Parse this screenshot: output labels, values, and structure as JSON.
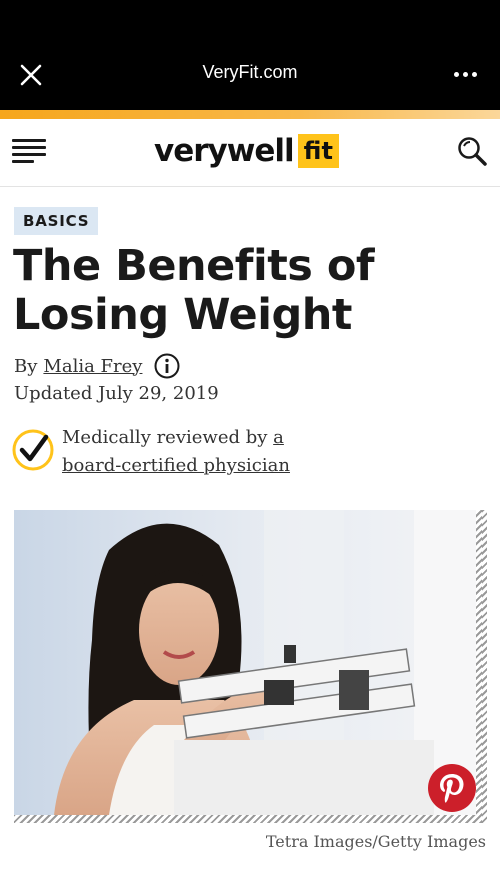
{
  "browser": {
    "title": "VeryFit.com",
    "close_icon": "close-icon",
    "more_icon": "more-options-icon"
  },
  "site": {
    "logo_text": "verywell",
    "logo_badge": "fit",
    "menu_icon": "hamburger-menu-icon",
    "search_icon": "search-icon",
    "accent_color": "#ffc31a"
  },
  "article": {
    "category": "BASICS",
    "title": "The Benefits of Losing Weight",
    "byline_prefix": "By",
    "author": "Malia Frey",
    "updated": "Updated July 29, 2019",
    "review_prefix": "Medically reviewed by",
    "review_link_a": "a",
    "review_link": "board-certified physician",
    "image_credit": "Tetra Images/Getty Images"
  }
}
